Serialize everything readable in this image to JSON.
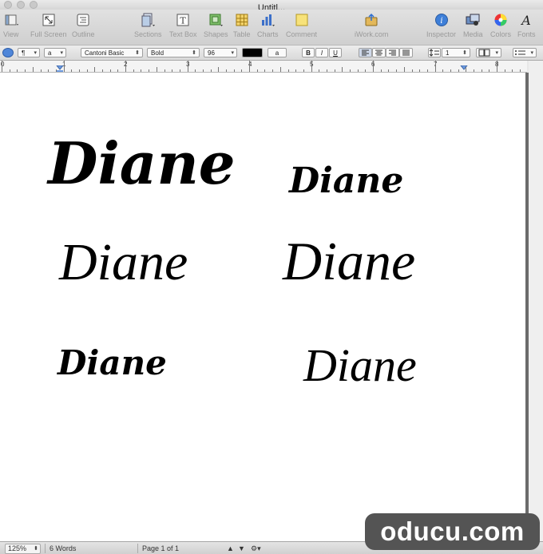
{
  "window": {
    "title": "Untitl..."
  },
  "toolbar": {
    "view": "View",
    "full_screen": "Full Screen",
    "outline": "Outline",
    "sections": "Sections",
    "text_box": "Text Box",
    "shapes": "Shapes",
    "table": "Table",
    "charts": "Charts",
    "comment": "Comment",
    "iwork": "iWork.com",
    "inspector": "Inspector",
    "media": "Media",
    "colors": "Colors",
    "fonts": "Fonts"
  },
  "format_bar": {
    "paragraph_style": "¶",
    "char_style": "a",
    "font_family": "Cantoni Basic",
    "font_style": "Bold",
    "font_size": "96",
    "text_color": "#000000",
    "bold": "B",
    "italic": "I",
    "underline": "U",
    "line_spacing": "1"
  },
  "ruler": {
    "numbers": [
      "0",
      "1",
      "2",
      "3",
      "4",
      "5",
      "6",
      "7",
      "8"
    ]
  },
  "document": {
    "samples": [
      "Diane",
      "Diane",
      "Diane",
      "Diane",
      "Diane",
      "Diane"
    ]
  },
  "status": {
    "zoom": "125%",
    "words": "6 Words",
    "page": "Page 1 of 1"
  },
  "watermark": "oducu.com",
  "colors": {
    "accent": "#2f6fd1",
    "text": "#000000"
  }
}
